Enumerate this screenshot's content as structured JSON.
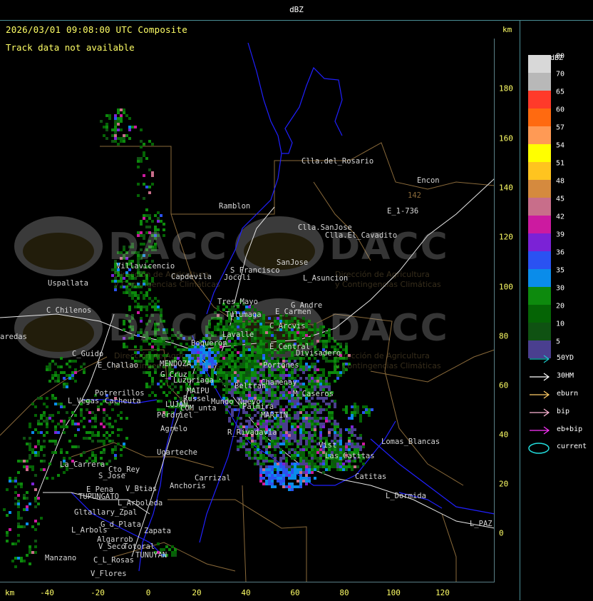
{
  "header": {
    "unit": "dBZ"
  },
  "map": {
    "title": "2026/03/01 09:08:00 UTC Composite",
    "status": "Track data not available",
    "axis_unit": "km",
    "x_ticks": [
      "-40",
      "-20",
      "0",
      "20",
      "40",
      "60",
      "80",
      "100",
      "120"
    ],
    "y_ticks": [
      "180",
      "160",
      "140",
      "120",
      "100",
      "80",
      "60",
      "40",
      "20",
      "0"
    ],
    "watermark": {
      "name": "DACC",
      "line1": "Dirección de Agricultura",
      "line2": "y Contingencias Climáticas"
    }
  },
  "scale": {
    "title": "dBZ",
    "levels": [
      {
        "label": "80",
        "color": "#d8d8d8"
      },
      {
        "label": "70",
        "color": "#b8b8b8"
      },
      {
        "label": "65",
        "color": "#ff3a2a"
      },
      {
        "label": "60",
        "color": "#ff6a10"
      },
      {
        "label": "57",
        "color": "#ff9a55"
      },
      {
        "label": "54",
        "color": "#ffff00"
      },
      {
        "label": "51",
        "color": "#ffc41f"
      },
      {
        "label": "48",
        "color": "#d58a3e"
      },
      {
        "label": "45",
        "color": "#c86e8a"
      },
      {
        "label": "42",
        "color": "#cc1aa0"
      },
      {
        "label": "39",
        "color": "#7b22d6"
      },
      {
        "label": "36",
        "color": "#2a52f2"
      },
      {
        "label": "35",
        "color": "#0a8cea"
      },
      {
        "label": "30",
        "color": "#0d8a0d"
      },
      {
        "label": "20",
        "color": "#056405"
      },
      {
        "label": "10",
        "color": "#0f5212"
      },
      {
        "label": "5",
        "color": "#4a3f8f"
      }
    ]
  },
  "tracks": [
    {
      "label": "50YD",
      "color": "#19c9c9",
      "icon": "arrow-icon"
    },
    {
      "label": "30HM",
      "color": "#ffffff",
      "icon": "arrow-icon"
    },
    {
      "label": "eburn",
      "color": "#ffcc66",
      "icon": "arrow-icon"
    },
    {
      "label": "bip",
      "color": "#ffb6d6",
      "icon": "arrow-icon"
    },
    {
      "label": "eb+bip",
      "color": "#ff33ff",
      "icon": "arrow-icon"
    },
    {
      "label": "current",
      "color": "#22dddd",
      "icon": "ellipse-icon"
    }
  ],
  "places": [
    {
      "name": "Clla.del_Rosario"
    },
    {
      "name": "Encon"
    },
    {
      "name": "142"
    },
    {
      "name": "E_1-736"
    },
    {
      "name": "Ramblon"
    },
    {
      "name": "Clla.SanJose"
    },
    {
      "name": "Clla.El_Cavadito"
    },
    {
      "name": "Villavicencio"
    },
    {
      "name": "Capdevila"
    },
    {
      "name": "S_Francisco"
    },
    {
      "name": "Jocoli"
    },
    {
      "name": "SanJose"
    },
    {
      "name": "L_Asuncion"
    },
    {
      "name": "Uspallata"
    },
    {
      "name": "Tres_Mayo"
    },
    {
      "name": "G_Andre"
    },
    {
      "name": "E_Carmen"
    },
    {
      "name": "C_Chilenos"
    },
    {
      "name": "Tulumaga"
    },
    {
      "name": "C_Arcvis"
    },
    {
      "name": "aredas"
    },
    {
      "name": "Boquerón"
    },
    {
      "name": "Lavalle"
    },
    {
      "name": "E_Central"
    },
    {
      "name": "Divisadero"
    },
    {
      "name": "C_Guido"
    },
    {
      "name": "MENDOZA"
    },
    {
      "name": "Portones"
    },
    {
      "name": "G_Cruz"
    },
    {
      "name": "Chamenay"
    },
    {
      "name": "Beltran"
    },
    {
      "name": "E_Challao"
    },
    {
      "name": "Luzuriaga"
    },
    {
      "name": "MAIPU"
    },
    {
      "name": "Russel"
    },
    {
      "name": "Mundo_Nuevo"
    },
    {
      "name": "Palmira"
    },
    {
      "name": "M_Caseros"
    },
    {
      "name": "Potrerillos"
    },
    {
      "name": "L_Vegas"
    },
    {
      "name": "Cacheuta"
    },
    {
      "name": "LUJAN"
    },
    {
      "name": "CUM_unta"
    },
    {
      "name": "Perdriel"
    },
    {
      "name": "MARTIN"
    },
    {
      "name": "Agrelo"
    },
    {
      "name": "R_Rivadavia"
    },
    {
      "name": "Lomas_Blancas"
    },
    {
      "name": "Ugarteche"
    },
    {
      "name": "La_Carrera"
    },
    {
      "name": "Cto_Rey"
    },
    {
      "name": "S_Jose"
    },
    {
      "name": "Carrizal"
    },
    {
      "name": "Catitas"
    },
    {
      "name": "E_Pena"
    },
    {
      "name": "TUPUNGATO"
    },
    {
      "name": "V_Btias"
    },
    {
      "name": "Anchoris"
    },
    {
      "name": "L_Dormida"
    },
    {
      "name": "L_Arboleda"
    },
    {
      "name": "Gltallary_Zpal"
    },
    {
      "name": "L_PAZ"
    },
    {
      "name": "G_d_Plata"
    },
    {
      "name": "L_Arbols"
    },
    {
      "name": "Zapata"
    },
    {
      "name": "Algarrob"
    },
    {
      "name": "V_Seco"
    },
    {
      "name": "Totoral"
    },
    {
      "name": "TUNUYAN"
    },
    {
      "name": "Manzano"
    },
    {
      "name": "C_L_Rosas"
    },
    {
      "name": "V_Flores"
    },
    {
      "name": "Las_Catitas"
    },
    {
      "name": "Vist"
    }
  ]
}
